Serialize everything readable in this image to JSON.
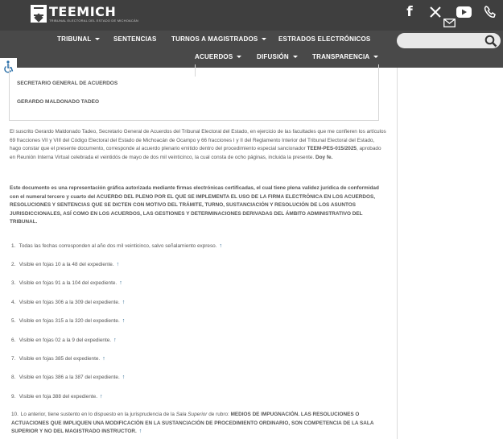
{
  "header": {
    "logo_title": "TEEMICH",
    "logo_subtitle": "TRIBUNAL ELECTORAL DEL ESTADO DE MICHOACÁN"
  },
  "nav": {
    "row1": [
      {
        "label": "TRIBUNAL",
        "dropdown": true
      },
      {
        "label": "SENTENCIAS",
        "dropdown": false
      },
      {
        "label": "TURNOS A MAGISTRADOS",
        "dropdown": true
      },
      {
        "label": "ESTRADOS ELECTRÓNICOS",
        "dropdown": false
      }
    ],
    "row2": [
      {
        "label": "ACUERDOS",
        "dropdown": true
      },
      {
        "label": "DIFUSIÓN",
        "dropdown": true
      },
      {
        "label": "TRANSPARENCIA",
        "dropdown": true
      }
    ],
    "search_placeholder": ""
  },
  "signature": {
    "role": "SECRETARIO GENERAL DE ACUERDOS",
    "name": "GERARDO MALDONADO TADEO"
  },
  "body": {
    "p1_a": "El suscrito Gerardo Maldonado Tadeo, Secretario General de Acuerdos del Tribunal Electoral del Estado, en ejercicio de las facultades que me confieren los artículos 69 fracciones VII y VIII del Código Electoral del Estado de Michoacán de Ocampo y 66 fracciones I y II del Reglamento Interior del Tribunal Electoral del Estado, hago constar que el presente documento, corresponde al acuerdo plenario emitido dentro del procedimiento especial sancionador ",
    "p1_case": "TEEM-PES-015/2025",
    "p1_b": ", aprobado en Reunión Interna Virtual celebrada el veintidós de mayo de dos mil veinticinco, la cual consta de ocho páginas, incluida la presente. ",
    "p1_end": "Doy fe.",
    "p2": "Este documento es una representación gráfica autorizada mediante firmas electrónicas certificadas, el cual tiene plena validez jurídica de conformidad con el numeral tercero y cuarto del ACUERDO DEL PLENO POR EL QUE SE IMPLEMENTA EL USO DE LA FIRMA ELECTRÓNICA EN LOS ACUERDOS, RESOLUCIONES Y SENTENCIAS QUE SE DICTEN CON MOTIVO DEL TRÁMITE, TURNO, SUSTANCIACIÓN Y RESOLUCIÓN DE LOS ASUNTOS JURISDICCIONALES, ASÍ COMO EN LOS ACUERDOS, LAS GESTIONES Y DETERMINACIONES DERIVADAS DEL ÁMBITO ADMINISTRATIVO DEL TRIBUNAL."
  },
  "footnotes": [
    {
      "num": "1.",
      "text": "Todas las fechas corresponden al año dos mil veinticinco, salvo señalamiento expreso."
    },
    {
      "num": "2.",
      "text": "Visible en fojas 10 a la 48 del expediente."
    },
    {
      "num": "3.",
      "text": "Visible en fojas 91 a la 104 del expediente."
    },
    {
      "num": "4.",
      "text": "Visible en fojas 306 a la 309 del expediente."
    },
    {
      "num": "5.",
      "text": "Visible en fojas 315 a la 320 del expediente."
    },
    {
      "num": "6.",
      "text": "Visible en fojas 02 a la 9 del expediente."
    },
    {
      "num": "7.",
      "text": "Visible en fojas 385 del expediente."
    },
    {
      "num": "8.",
      "text": "Visible en fojas 386 a la 387 del expediente."
    },
    {
      "num": "9.",
      "text": "Visible en foja 388 del expediente."
    }
  ],
  "footnote10": {
    "num": "10.",
    "a": "Lo anterior, tiene sustento en lo dispuesto en la jurisprudencia de la ",
    "ital": "Sala Superior",
    "b": " de rubro: ",
    "bold": "MEDIOS DE IMPUGNACIÓN. LAS RESOLUCIONES O ACTUACIONES QUE IMPLIQUEN UNA MODIFICACIÓN EN LA SUSTANCIACIÓN DE PROCEDIMIENTO ORDINARIO, SON COMPETENCIA DE LA SALA SUPERIOR Y NO DEL MAGISTRADO INSTRUCTOR."
  },
  "backref_glyph": "↑"
}
